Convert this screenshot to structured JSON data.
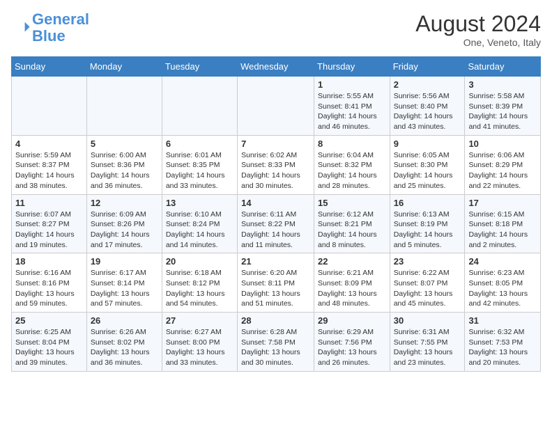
{
  "header": {
    "logo_line1": "General",
    "logo_line2": "Blue",
    "month_year": "August 2024",
    "location": "One, Veneto, Italy"
  },
  "weekdays": [
    "Sunday",
    "Monday",
    "Tuesday",
    "Wednesday",
    "Thursday",
    "Friday",
    "Saturday"
  ],
  "weeks": [
    [
      {
        "day": "",
        "info": ""
      },
      {
        "day": "",
        "info": ""
      },
      {
        "day": "",
        "info": ""
      },
      {
        "day": "",
        "info": ""
      },
      {
        "day": "1",
        "info": "Sunrise: 5:55 AM\nSunset: 8:41 PM\nDaylight: 14 hours and 46 minutes."
      },
      {
        "day": "2",
        "info": "Sunrise: 5:56 AM\nSunset: 8:40 PM\nDaylight: 14 hours and 43 minutes."
      },
      {
        "day": "3",
        "info": "Sunrise: 5:58 AM\nSunset: 8:39 PM\nDaylight: 14 hours and 41 minutes."
      }
    ],
    [
      {
        "day": "4",
        "info": "Sunrise: 5:59 AM\nSunset: 8:37 PM\nDaylight: 14 hours and 38 minutes."
      },
      {
        "day": "5",
        "info": "Sunrise: 6:00 AM\nSunset: 8:36 PM\nDaylight: 14 hours and 36 minutes."
      },
      {
        "day": "6",
        "info": "Sunrise: 6:01 AM\nSunset: 8:35 PM\nDaylight: 14 hours and 33 minutes."
      },
      {
        "day": "7",
        "info": "Sunrise: 6:02 AM\nSunset: 8:33 PM\nDaylight: 14 hours and 30 minutes."
      },
      {
        "day": "8",
        "info": "Sunrise: 6:04 AM\nSunset: 8:32 PM\nDaylight: 14 hours and 28 minutes."
      },
      {
        "day": "9",
        "info": "Sunrise: 6:05 AM\nSunset: 8:30 PM\nDaylight: 14 hours and 25 minutes."
      },
      {
        "day": "10",
        "info": "Sunrise: 6:06 AM\nSunset: 8:29 PM\nDaylight: 14 hours and 22 minutes."
      }
    ],
    [
      {
        "day": "11",
        "info": "Sunrise: 6:07 AM\nSunset: 8:27 PM\nDaylight: 14 hours and 19 minutes."
      },
      {
        "day": "12",
        "info": "Sunrise: 6:09 AM\nSunset: 8:26 PM\nDaylight: 14 hours and 17 minutes."
      },
      {
        "day": "13",
        "info": "Sunrise: 6:10 AM\nSunset: 8:24 PM\nDaylight: 14 hours and 14 minutes."
      },
      {
        "day": "14",
        "info": "Sunrise: 6:11 AM\nSunset: 8:22 PM\nDaylight: 14 hours and 11 minutes."
      },
      {
        "day": "15",
        "info": "Sunrise: 6:12 AM\nSunset: 8:21 PM\nDaylight: 14 hours and 8 minutes."
      },
      {
        "day": "16",
        "info": "Sunrise: 6:13 AM\nSunset: 8:19 PM\nDaylight: 14 hours and 5 minutes."
      },
      {
        "day": "17",
        "info": "Sunrise: 6:15 AM\nSunset: 8:18 PM\nDaylight: 14 hours and 2 minutes."
      }
    ],
    [
      {
        "day": "18",
        "info": "Sunrise: 6:16 AM\nSunset: 8:16 PM\nDaylight: 13 hours and 59 minutes."
      },
      {
        "day": "19",
        "info": "Sunrise: 6:17 AM\nSunset: 8:14 PM\nDaylight: 13 hours and 57 minutes."
      },
      {
        "day": "20",
        "info": "Sunrise: 6:18 AM\nSunset: 8:12 PM\nDaylight: 13 hours and 54 minutes."
      },
      {
        "day": "21",
        "info": "Sunrise: 6:20 AM\nSunset: 8:11 PM\nDaylight: 13 hours and 51 minutes."
      },
      {
        "day": "22",
        "info": "Sunrise: 6:21 AM\nSunset: 8:09 PM\nDaylight: 13 hours and 48 minutes."
      },
      {
        "day": "23",
        "info": "Sunrise: 6:22 AM\nSunset: 8:07 PM\nDaylight: 13 hours and 45 minutes."
      },
      {
        "day": "24",
        "info": "Sunrise: 6:23 AM\nSunset: 8:05 PM\nDaylight: 13 hours and 42 minutes."
      }
    ],
    [
      {
        "day": "25",
        "info": "Sunrise: 6:25 AM\nSunset: 8:04 PM\nDaylight: 13 hours and 39 minutes."
      },
      {
        "day": "26",
        "info": "Sunrise: 6:26 AM\nSunset: 8:02 PM\nDaylight: 13 hours and 36 minutes."
      },
      {
        "day": "27",
        "info": "Sunrise: 6:27 AM\nSunset: 8:00 PM\nDaylight: 13 hours and 33 minutes."
      },
      {
        "day": "28",
        "info": "Sunrise: 6:28 AM\nSunset: 7:58 PM\nDaylight: 13 hours and 30 minutes."
      },
      {
        "day": "29",
        "info": "Sunrise: 6:29 AM\nSunset: 7:56 PM\nDaylight: 13 hours and 26 minutes."
      },
      {
        "day": "30",
        "info": "Sunrise: 6:31 AM\nSunset: 7:55 PM\nDaylight: 13 hours and 23 minutes."
      },
      {
        "day": "31",
        "info": "Sunrise: 6:32 AM\nSunset: 7:53 PM\nDaylight: 13 hours and 20 minutes."
      }
    ]
  ]
}
